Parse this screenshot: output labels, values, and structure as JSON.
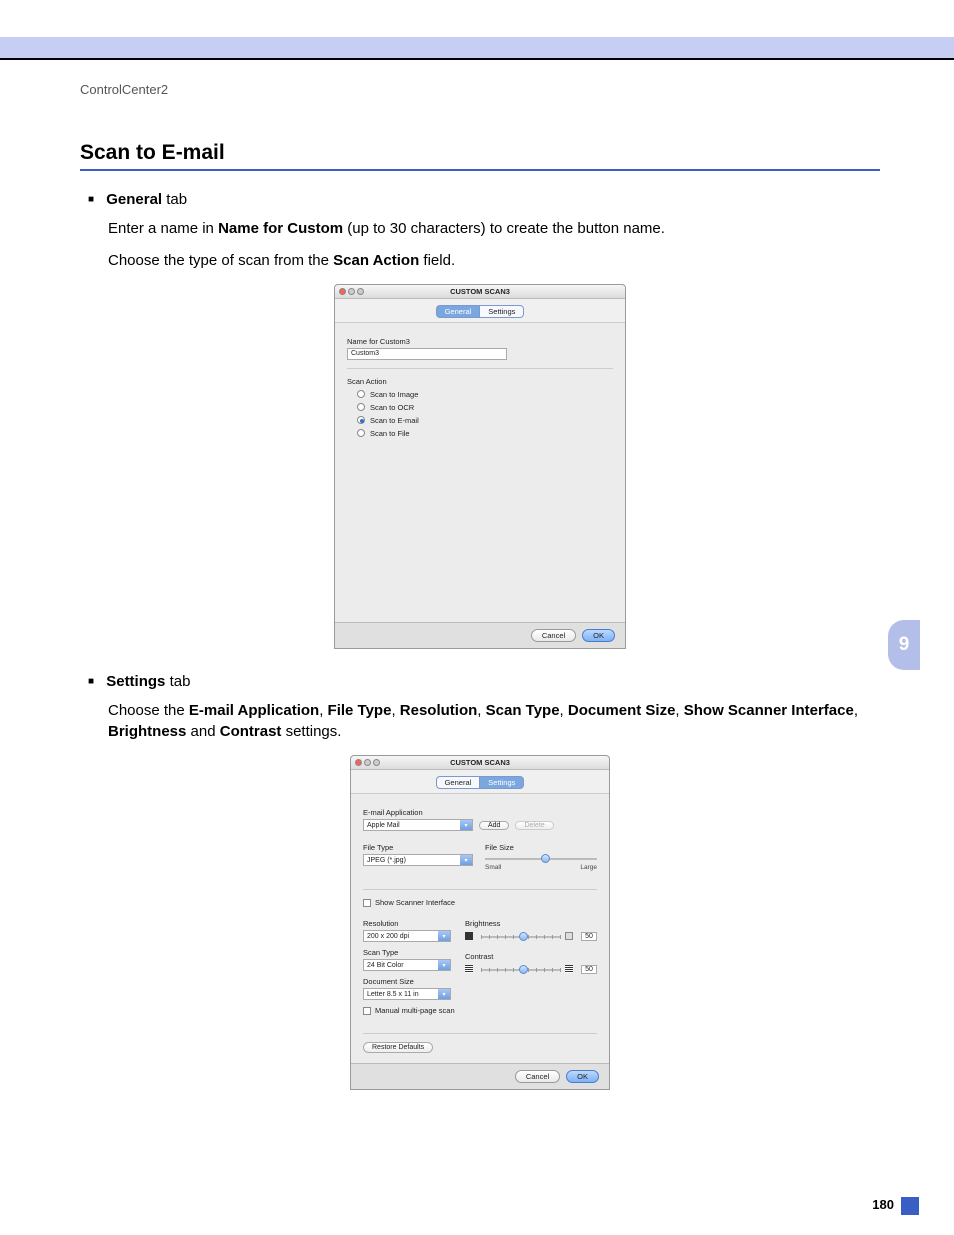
{
  "breadcrumb": "ControlCenter2",
  "section_title": "Scan to E-mail",
  "chapter_number": "9",
  "page_number": "180",
  "general": {
    "bullet_label_bold": "General",
    "bullet_label_rest": " tab",
    "line1_pre": "Enter a name in ",
    "line1_bold": "Name for Custom",
    "line1_post": " (up to 30 characters) to create the button name.",
    "line2_pre": "Choose the type of scan from the ",
    "line2_bold": "Scan Action",
    "line2_post": " field."
  },
  "settings": {
    "bullet_label_bold": "Settings",
    "bullet_label_rest": " tab",
    "line1_a": "Choose the ",
    "line1_b1": "E-mail Application",
    "line1_c1": ", ",
    "line1_b2": "File Type",
    "line1_c2": ", ",
    "line1_b3": "Resolution",
    "line1_c3": ", ",
    "line1_b4": "Scan Type",
    "line1_c4": ", ",
    "line1_b5": "Document Size",
    "line1_c5": ", ",
    "line1_b6": "Show Scanner Interface",
    "line1_c6": ", ",
    "line1_b7": "Brightness",
    "line1_c7": " and ",
    "line1_b8": "Contrast",
    "line1_c8": " settings."
  },
  "win1": {
    "title": "CUSTOM SCAN3",
    "tab_general": "General",
    "tab_settings": "Settings",
    "name_for_custom_label": "Name for Custom3",
    "name_for_custom_value": "Custom3",
    "scan_action_label": "Scan Action",
    "opt_image": "Scan to Image",
    "opt_ocr": "Scan to OCR",
    "opt_email": "Scan to E-mail",
    "opt_file": "Scan to File",
    "cancel": "Cancel",
    "ok": "OK"
  },
  "win2": {
    "title": "CUSTOM SCAN3",
    "tab_general": "General",
    "tab_settings": "Settings",
    "email_app_label": "E-mail Application",
    "email_app_value": "Apple Mail",
    "add": "Add",
    "delete": "Delete",
    "file_type_label": "File Type",
    "file_type_value": "JPEG (*.jpg)",
    "file_size_label": "File Size",
    "file_size_small": "Small",
    "file_size_large": "Large",
    "show_scanner": "Show Scanner Interface",
    "resolution_label": "Resolution",
    "resolution_value": "200 x 200 dpi",
    "scan_type_label": "Scan Type",
    "scan_type_value": "24 Bit Color",
    "doc_size_label": "Document Size",
    "doc_size_value": "Letter  8.5 x 11 in",
    "brightness_label": "Brightness",
    "brightness_value": "50",
    "contrast_label": "Contrast",
    "contrast_value": "50",
    "manual_multi": "Manual multi-page scan",
    "restore": "Restore Defaults",
    "cancel": "Cancel",
    "ok": "OK"
  }
}
